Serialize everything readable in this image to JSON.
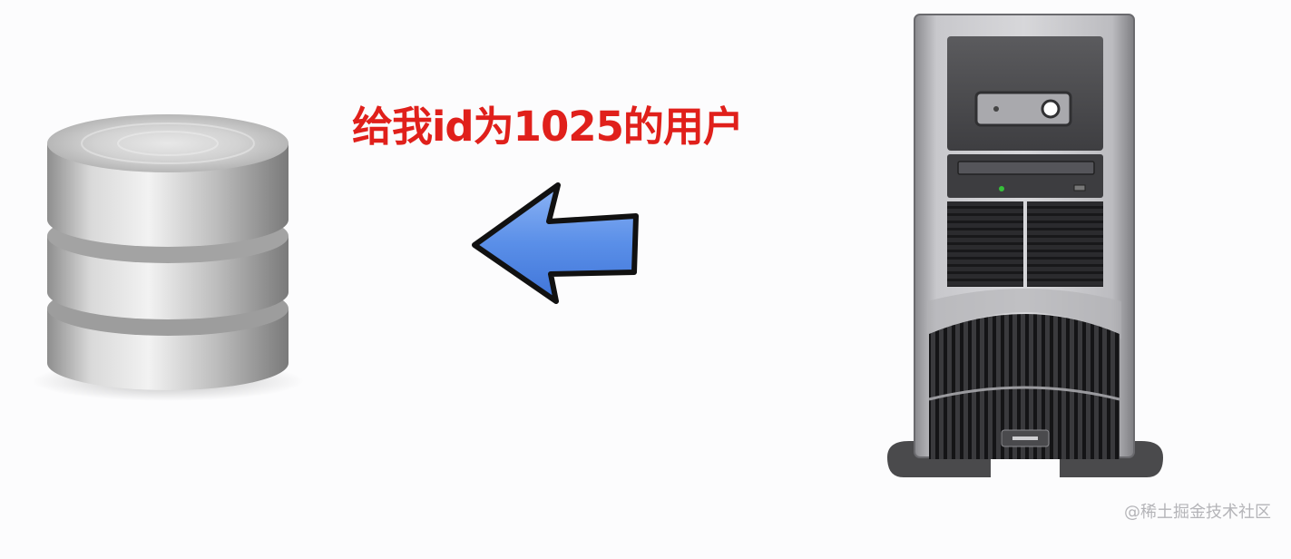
{
  "request_message": "给我id为1025的用户",
  "watermark": "@稀土掘金技术社区",
  "icons": {
    "database": "database-icon",
    "arrow": "arrow-left-icon",
    "server": "server-tower-icon"
  },
  "colors": {
    "message": "#e0201b",
    "arrow_fill": "#5a8fe8",
    "arrow_outline": "#111111",
    "watermark": "#b4b4b8"
  }
}
